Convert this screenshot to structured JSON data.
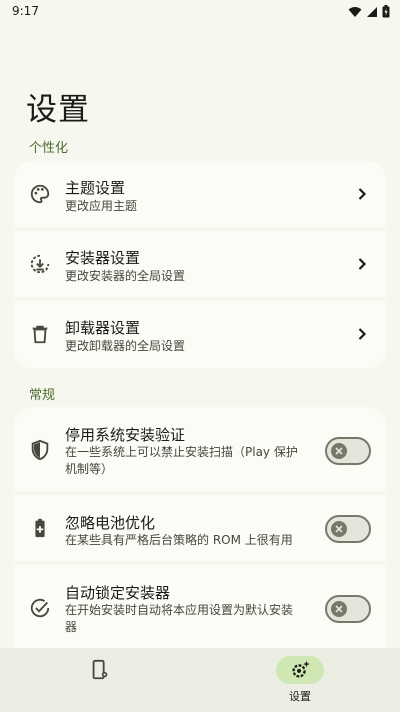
{
  "status_bar": {
    "time": "9:17"
  },
  "page": {
    "title": "设置"
  },
  "sections": {
    "personalization": {
      "label": "个性化",
      "items": [
        {
          "title": "主题设置",
          "subtitle": "更改应用主题",
          "icon": "palette-icon"
        },
        {
          "title": "安装器设置",
          "subtitle": "更改安装器的全局设置",
          "icon": "download-circle-icon"
        },
        {
          "title": "卸载器设置",
          "subtitle": "更改卸载器的全局设置",
          "icon": "trash-icon"
        }
      ]
    },
    "general": {
      "label": "常规",
      "items": [
        {
          "title": "停用系统安装验证",
          "subtitle_line1": "在一些系统上可以禁止安装扫描（Play 保护",
          "subtitle_line2": "机制等）",
          "icon": "shield-icon",
          "toggle": false
        },
        {
          "title": "忽略电池优化",
          "subtitle_line1": "在某些具有严格后台策略的 ROM 上很有用",
          "icon": "battery-plus-icon",
          "toggle": false
        },
        {
          "title": "自动锁定安装器",
          "subtitle_line1": "在开始安装时自动将本应用设置为默认安装",
          "subtitle_line2": "器",
          "icon": "check-circle-icon",
          "toggle": false
        }
      ]
    }
  },
  "bottom_nav": {
    "items": [
      {
        "label": "",
        "icon": "app-settings-icon",
        "selected": false
      },
      {
        "label": "设置",
        "icon": "settings-sparkle-icon",
        "selected": true
      }
    ]
  },
  "colors": {
    "accent": "#4c6b2e",
    "background": "#f6f7ef",
    "card": "#fbfcf6",
    "nav_pill": "#cfe8b3"
  }
}
